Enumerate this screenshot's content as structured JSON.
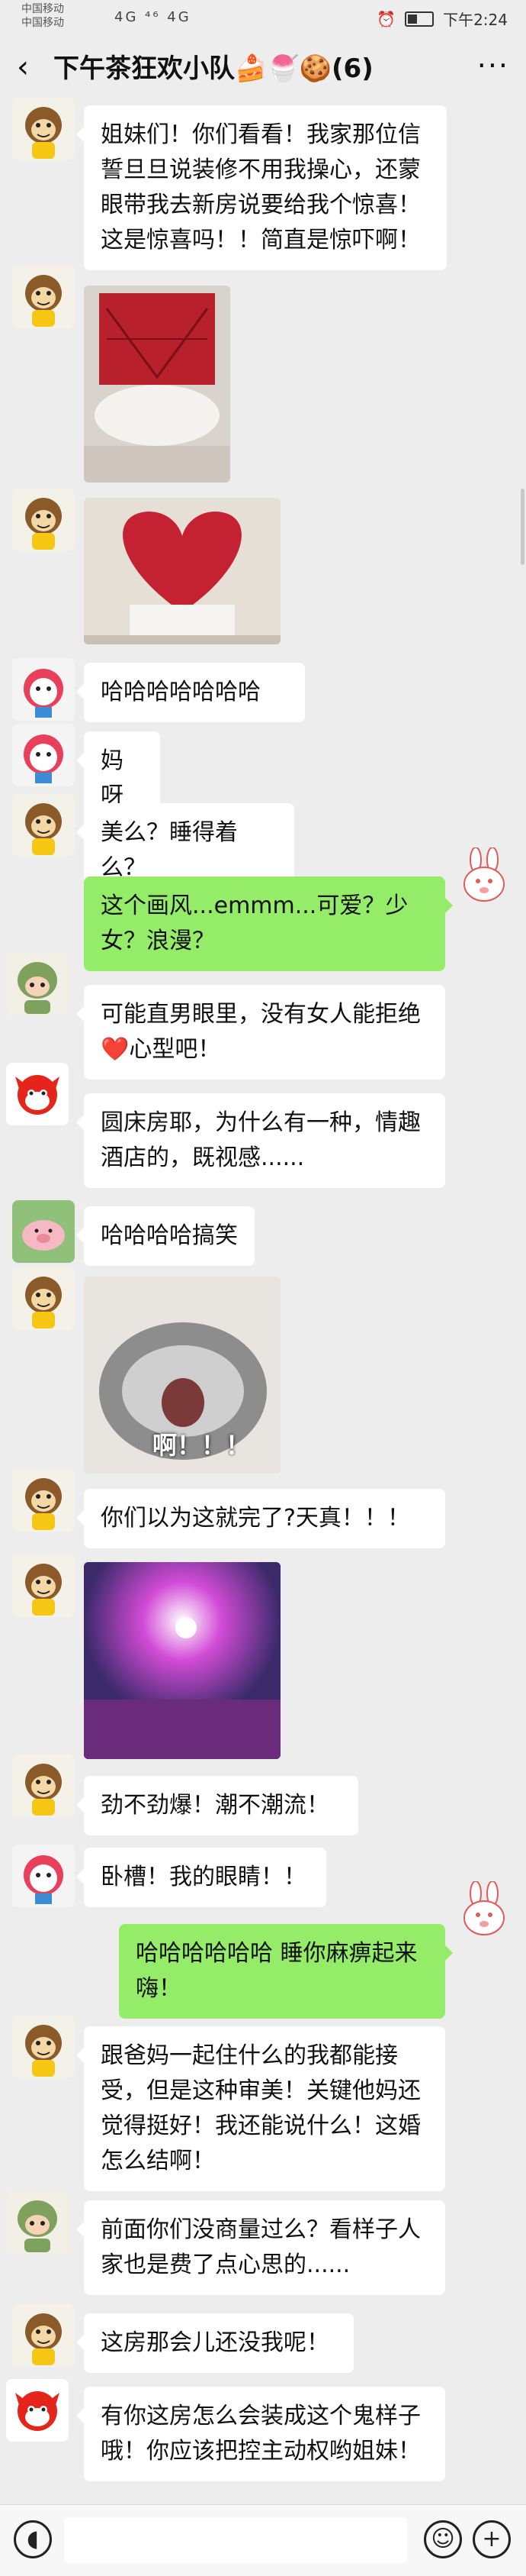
{
  "status": {
    "carrier1": "中国移动",
    "carrier2": "中国移动",
    "time": "下午2:24",
    "network": "4G ⁴⁶ 4G"
  },
  "header": {
    "back_icon": "chevron-left-icon",
    "title": "下午茶狂欢小队🍰🍧🍪(6)",
    "more_icon": "more-icon"
  },
  "messages": [
    {
      "text": "姐妹们！你们看看！我家那位信誓旦旦说装修不用我操心，还蒙眼带我去新房说要给我个惊喜！这是惊喜吗！！简直是惊吓啊！"
    },
    {
      "image": "red-heart-headboard-bed"
    },
    {
      "image": "red-heart-headboard-bed-2"
    },
    {
      "text": "哈哈哈哈哈哈哈"
    },
    {
      "text": "妈呀"
    },
    {
      "text": "美么？睡得着么？"
    },
    {
      "text": "这个画风...emmm...可爱？少女？浪漫？"
    },
    {
      "text": "可能直男眼里，没有女人能拒绝❤️心型吧！"
    },
    {
      "text": "圆床房耶，为什么有一种，情趣酒店的，既视感......"
    },
    {
      "text": "哈哈哈哈搞笑"
    },
    {
      "image": "screaming-cat-sticker",
      "caption": "啊！！！"
    },
    {
      "text": "你们以为这就完了?天真！！！"
    },
    {
      "image": "colorful-ceiling-lights"
    },
    {
      "text": "劲不劲爆！潮不潮流！"
    },
    {
      "text": "卧槽！我的眼睛！！"
    },
    {
      "text": "哈哈哈哈哈哈 睡你麻痹起来嗨！"
    },
    {
      "text": "跟爸妈一起住什么的我都能接受，但是这种审美！关键他妈还觉得挺好！我还能说什么！这婚怎么结啊！"
    },
    {
      "text": "前面你们没商量过么？看样子人家也是费了点心思的......"
    },
    {
      "text": "这房那会儿还没我呢！"
    },
    {
      "text": "有你这房怎么会装成这个鬼样子哦！你应该把控主动权哟姐妹！"
    }
  ],
  "inputbar": {
    "voice_icon": "voice-icon",
    "emoji_icon": "emoji-icon",
    "plus_icon": "plus-icon"
  },
  "colors": {
    "bg": "#ededed",
    "my_bubble": "#95ec69",
    "other_bubble": "#ffffff"
  }
}
